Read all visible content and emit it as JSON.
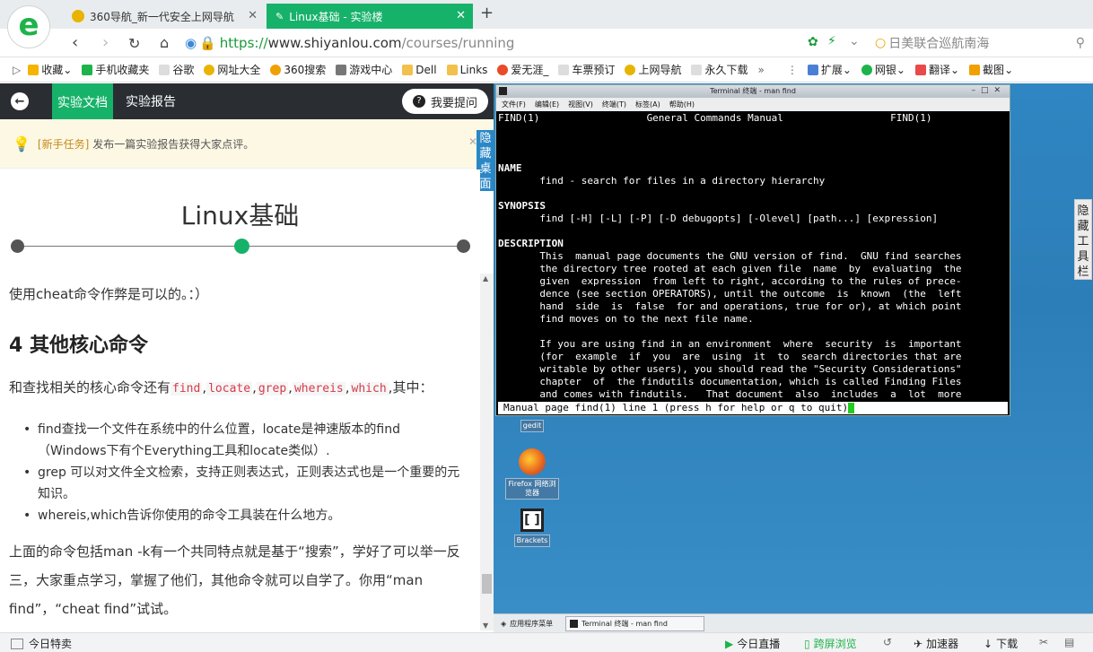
{
  "browser": {
    "tabs": [
      {
        "label": "360导航_新一代安全上网导航"
      },
      {
        "label": "Linux基础 - 实验楼"
      }
    ],
    "url": {
      "proto": "https://",
      "domain": "www.shiyanlou.com",
      "path": "/courses/running"
    },
    "search_text": "日美联合巡航南海",
    "bookmarks": [
      "收藏",
      "手机收藏夹",
      "谷歌",
      "网址大全",
      "360搜索",
      "游戏中心",
      "Dell",
      "Links",
      "爱无涯_",
      "车票预订",
      "上网导航",
      "永久下载"
    ],
    "ext_items": [
      "扩展",
      "网银",
      "翻译",
      "截图"
    ]
  },
  "doc_header": {
    "tab_doc": "实验文档",
    "tab_report": "实验报告",
    "ask_button": "我要提问"
  },
  "notice": {
    "tag": "[新手任务]",
    "text": "发布一篇实验报告获得大家点评。"
  },
  "hide_desktop": "隐藏桌面",
  "hide_tools": "隐藏工具栏",
  "doc": {
    "title": "Linux基础",
    "progress_current": 2,
    "progress_total": 3,
    "para1": "使用cheat命令作弊是可以的。：）",
    "heading": "4 其他核心命令",
    "para2_prefix": "和查找相关的核心命令还有",
    "codes": [
      "find",
      "locate",
      "grep",
      "whereis",
      "which"
    ],
    "para2_suffix": ",其中：",
    "bullets": [
      "find查找一个文件在系统中的什么位置，locate是神速版本的find（Windows下有个Everything工具和locate类似）.",
      "grep 可以对文件全文检索，支持正则表达式，正则表达式也是一个重要的元知识。",
      "whereis,which告诉你使用的命令工具装在什么地方。"
    ],
    "para3": "上面的命令包括man -k有一个共同特点就是基于“搜索”，学好了可以举一反三，大家重点学习，掌握了他们，其他命令就可以自学了。你用“man find”，“cheat find”试试。"
  },
  "terminal": {
    "title": "Terminal 终端 - man find",
    "menu": [
      "文件(F)",
      "编辑(E)",
      "视图(V)",
      "终端(T)",
      "标签(A)",
      "帮助(H)"
    ],
    "lines": [
      "FIND(1)                  General Commands Manual                  FIND(1)",
      "",
      "",
      "",
      "NAME",
      "       find - search for files in a directory hierarchy",
      "",
      "SYNOPSIS",
      "       find [-H] [-L] [-P] [-D debugopts] [-Olevel] [path...] [expression]",
      "",
      "DESCRIPTION",
      "       This  manual page documents the GNU version of find.  GNU find searches",
      "       the directory tree rooted at each given file  name  by  evaluating  the",
      "       given  expression  from left to right, according to the rules of prece-",
      "       dence (see section OPERATORS), until the outcome  is  known  (the  left",
      "       hand  side  is  false  for and operations, true for or), at which point",
      "       find moves on to the next file name.",
      "",
      "       If you are using find in an environment  where  security  is  important",
      "       (for  example  if  you  are  using  it  to  search directories that are",
      "       writable by other users), you should read the \"Security Considerations\"",
      "       chapter  of  the findutils documentation, which is called Finding Files",
      "       and comes with findutils.   That document  also  includes  a  lot  more"
    ],
    "status": "Manual page find(1) line 1 (press h for help or q to quit)"
  },
  "desktop_icons": [
    {
      "label": "gedit"
    },
    {
      "label": "Firefox 网络浏览器"
    },
    {
      "label": "Brackets"
    }
  ],
  "vm_taskbar": {
    "apps_menu": "应用程序菜单",
    "task": "Terminal 终端 - man find"
  },
  "statusbar": {
    "left": "今日特卖",
    "items": [
      "今日直播",
      "跨屏浏览",
      "加速器",
      "下载"
    ]
  }
}
